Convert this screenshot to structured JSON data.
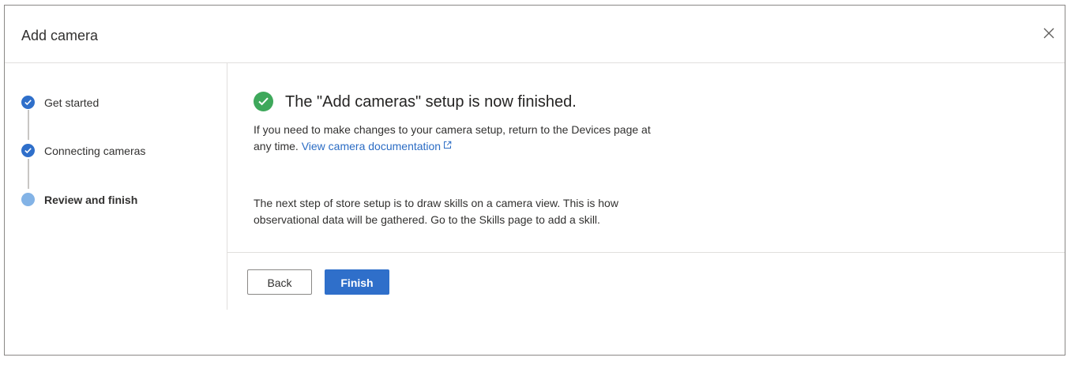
{
  "dialog": {
    "title": "Add camera",
    "close_icon": "close-icon"
  },
  "stepper": {
    "steps": [
      {
        "label": "Get started",
        "status": "completed",
        "icon": "checkmark-icon"
      },
      {
        "label": "Connecting cameras",
        "status": "completed",
        "icon": "checkmark-icon"
      },
      {
        "label": "Review and finish",
        "status": "current",
        "icon": "current-step-dot"
      }
    ]
  },
  "content": {
    "headline": "The \"Add cameras\" setup is now finished.",
    "success_icon": "success-checkmark-icon",
    "paragraph1_text": "If you need to make changes to your camera setup, return to the Devices page at any time.",
    "doc_link_label": "View camera documentation",
    "link_icon": "external-link-icon",
    "paragraph2": "The next step of store setup is to draw skills on a camera view. This is how observational data will be gathered. Go to the Skills page to add a skill."
  },
  "footer": {
    "back_label": "Back",
    "finish_label": "Finish"
  },
  "colors": {
    "accent": "#2f6fca",
    "success": "#3ea85b",
    "current_step": "#83b3e6",
    "link": "#2b6cc4"
  }
}
